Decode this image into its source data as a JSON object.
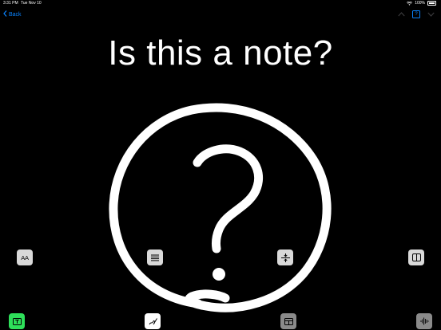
{
  "status_bar": {
    "time": "3:31 PM",
    "date": "Tue Nov 10",
    "battery": "100%"
  },
  "nav": {
    "back_label": "Back",
    "help_label": "?"
  },
  "note": {
    "title": "Is this a note?"
  },
  "toolbar": {
    "text_style_label": "AA"
  },
  "icons": [
    "back-chevron-icon",
    "wifi-icon",
    "battery-icon",
    "chevron-up-icon",
    "chevron-down-icon",
    "help-icon",
    "text-style-icon",
    "list-icon",
    "insert-space-icon",
    "split-view-icon",
    "text-mode-icon",
    "draw-mode-icon",
    "layout-icon",
    "audio-icon"
  ],
  "colors": {
    "accent": "#0a84ff",
    "background": "#000000",
    "active_tool": "#2ee05a"
  }
}
